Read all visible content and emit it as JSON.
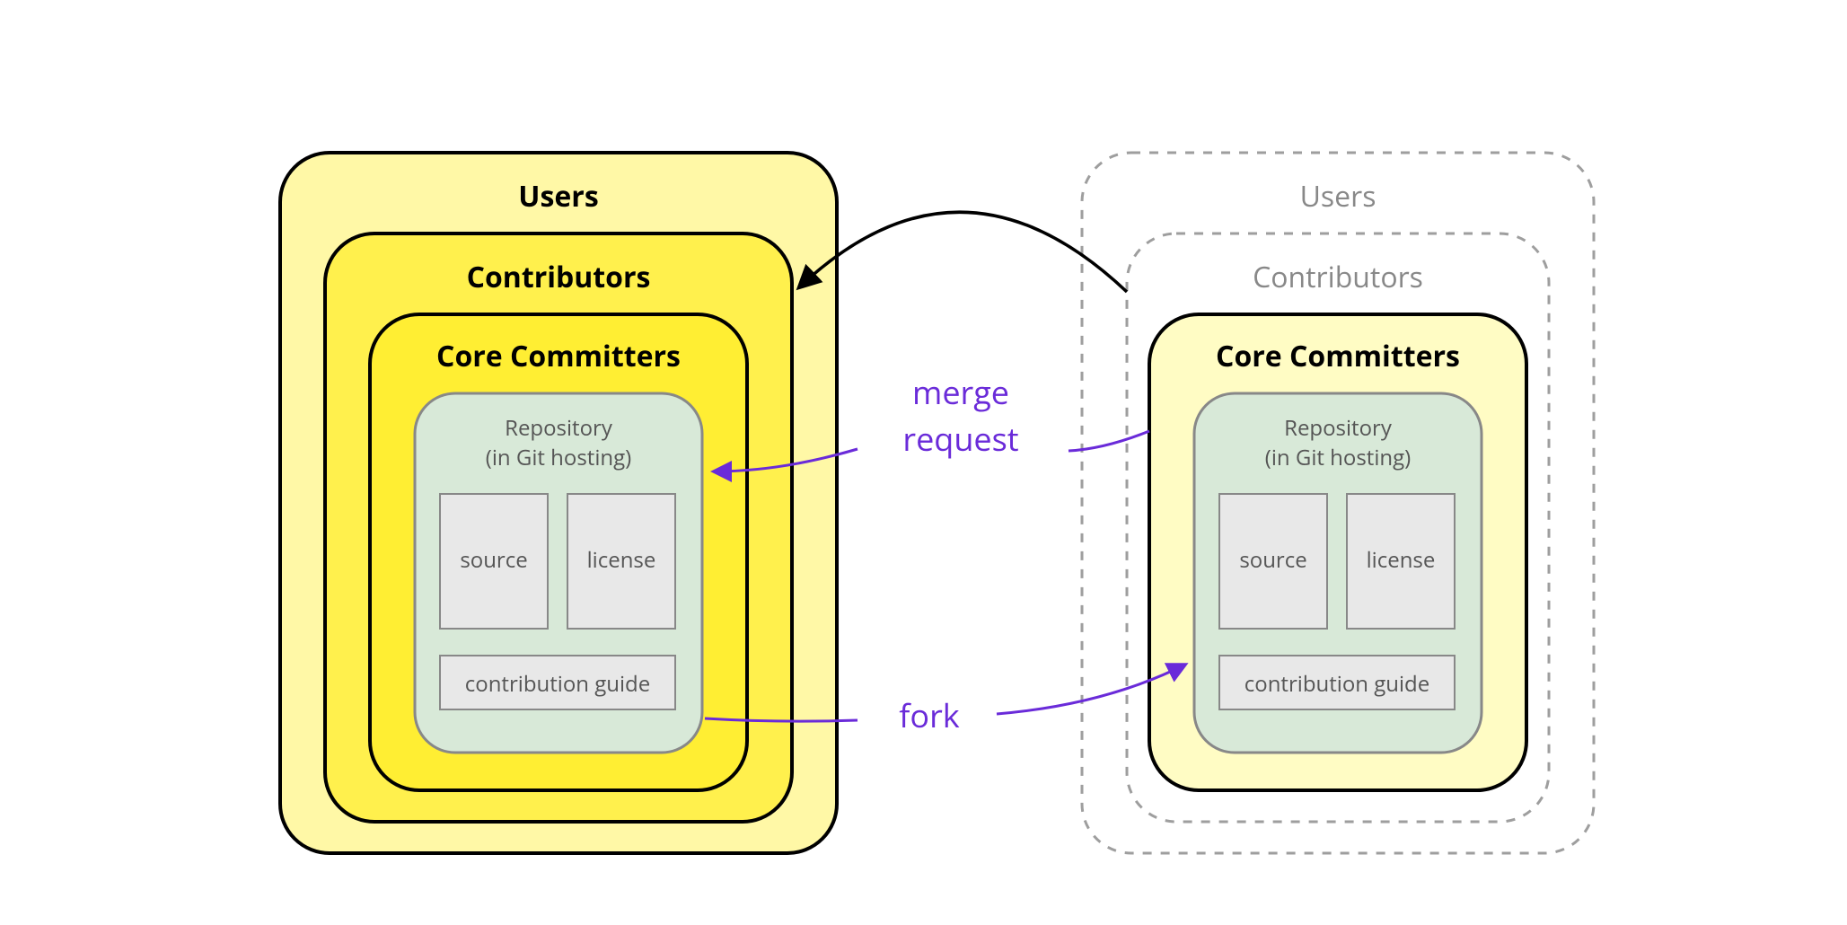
{
  "left": {
    "users": "Users",
    "contributors": "Contributors",
    "core": "Core Committers",
    "repo_title": "Repository",
    "repo_sub": "(in Git hosting)",
    "source": "source",
    "license": "license",
    "guide": "contribution guide"
  },
  "right": {
    "users": "Users",
    "contributors": "Contributors",
    "core": "Core Committers",
    "repo_title": "Repository",
    "repo_sub": "(in Git hosting)",
    "source": "source",
    "license": "license",
    "guide": "contribution guide"
  },
  "labels": {
    "merge1": "merge",
    "merge2": "request",
    "fork": "fork"
  },
  "colors": {
    "yellow_outer": "#fff8a6",
    "yellow_mid": "#fff04d",
    "yellow_inner": "#ffee33",
    "yellow_light": "#fffcc4",
    "repo_bg": "#d8e9d8",
    "box_bg": "#e8e8e8",
    "purple": "#6a2bd9",
    "gray_dash": "#9e9e9e"
  }
}
